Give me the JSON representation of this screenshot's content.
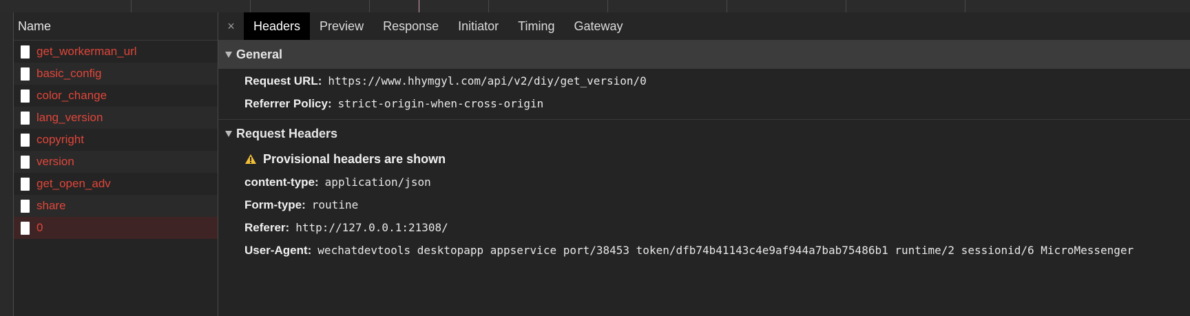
{
  "request_list": {
    "header": "Name",
    "items": [
      {
        "name": "get_workerman_url"
      },
      {
        "name": "basic_config"
      },
      {
        "name": "color_change"
      },
      {
        "name": "lang_version"
      },
      {
        "name": "copyright"
      },
      {
        "name": "version"
      },
      {
        "name": "get_open_adv"
      },
      {
        "name": "share"
      },
      {
        "name": "0",
        "selected": true
      }
    ]
  },
  "tabs": {
    "close_glyph": "×",
    "items": [
      "Headers",
      "Preview",
      "Response",
      "Initiator",
      "Timing",
      "Gateway"
    ],
    "active": "Headers"
  },
  "general": {
    "title": "General",
    "rows": [
      {
        "key": "Request URL:",
        "value": "https://www.hhymgyl.com/api/v2/diy/get_version/0"
      },
      {
        "key": "Referrer Policy:",
        "value": "strict-origin-when-cross-origin"
      }
    ]
  },
  "request_headers": {
    "title": "Request Headers",
    "warning": "Provisional headers are shown",
    "rows": [
      {
        "key": "content-type:",
        "value": "application/json"
      },
      {
        "key": "Form-type:",
        "value": "routine"
      },
      {
        "key": "Referer:",
        "value": "http://127.0.0.1:21308/"
      },
      {
        "key": "User-Agent:",
        "value": "wechatdevtools desktopapp appservice port/38453 token/dfb74b41143c4e9af944a7bab75486b1 runtime/2 sessionid/6 MicroMessenger"
      }
    ]
  },
  "colors": {
    "request_name": "#e0463a",
    "selected_row": "#3e2424",
    "warning": "#f2c037"
  }
}
